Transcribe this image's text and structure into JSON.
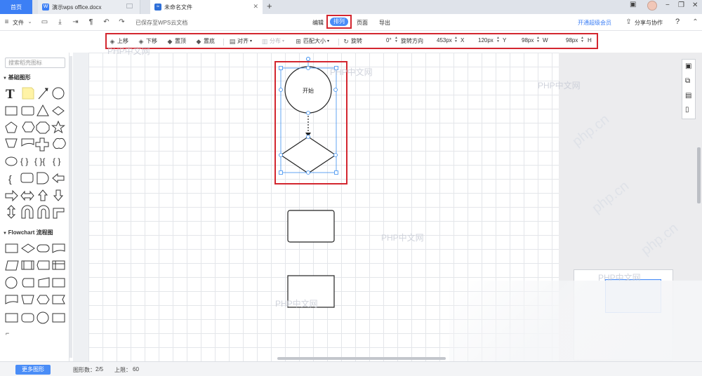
{
  "titlebar": {
    "home_tab": "首页",
    "doc_tab": "演示wps office.docx",
    "active_tab": "未命名文件",
    "new_tab": "+"
  },
  "menubar": {
    "file": "文件",
    "saved_status": "已保存至WPS云文档",
    "tabs": [
      "编辑",
      "排列",
      "页面",
      "导出"
    ],
    "active_tab": "排列",
    "vip": "开通超级会员",
    "share": "分享与协作",
    "help": "?"
  },
  "toolbar": {
    "move_up": "上移",
    "move_down": "下移",
    "to_top": "置顶",
    "to_bottom": "置底",
    "align": "对齐",
    "distribute": "分布",
    "match_size": "匹配大小",
    "rotate": "旋转",
    "rotate_value": "0°",
    "rotate_direction": "旋转方向",
    "x_value": "453px",
    "x_label": "X",
    "y_value": "120px",
    "y_label": "Y",
    "w_value": "98px",
    "w_label": "W",
    "h_value": "98px",
    "h_label": "H"
  },
  "sidebar": {
    "search_placeholder": "搜索稻壳图标",
    "section_basic": "基础图形",
    "section_flowchart": "Flowchart 流程图",
    "more_shapes": "更多图形"
  },
  "canvas": {
    "start_label": "开始",
    "watermark": "PHP中文网",
    "watermark_rotated": "php.cn"
  },
  "statusbar": {
    "shape_count_label": "图形数：",
    "shape_count": "2/5",
    "limit_label": "上限：",
    "limit": "60"
  },
  "colors": {
    "accent": "#4a8df7",
    "highlight": "#d3262f",
    "home_tab": "#3c7ff5"
  }
}
